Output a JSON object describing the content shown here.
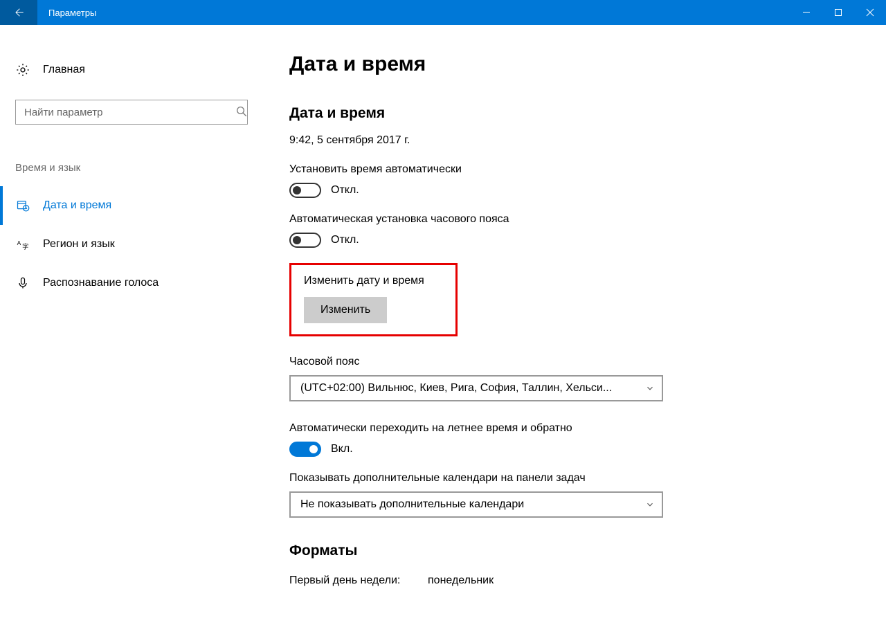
{
  "titlebar": {
    "title": "Параметры"
  },
  "sidebar": {
    "home": "Главная",
    "search_placeholder": "Найти параметр",
    "category": "Время и язык",
    "items": [
      {
        "label": "Дата и время"
      },
      {
        "label": "Регион и язык"
      },
      {
        "label": "Распознавание голоса"
      }
    ]
  },
  "content": {
    "page_title": "Дата и время",
    "section_title": "Дата и время",
    "current_datetime": "9:42, 5 сентября 2017 г.",
    "auto_time": {
      "label": "Установить время автоматически",
      "state": "Откл."
    },
    "auto_tz": {
      "label": "Автоматическая установка часового пояса",
      "state": "Откл."
    },
    "change": {
      "label": "Изменить дату и время",
      "button": "Изменить"
    },
    "timezone": {
      "label": "Часовой пояс",
      "value": "(UTC+02:00) Вильнюс, Киев, Рига, София, Таллин, Хельси..."
    },
    "dst": {
      "label": "Автоматически переходить на летнее время и обратно",
      "state": "Вкл."
    },
    "extra_cal": {
      "label": "Показывать дополнительные календари на панели задач",
      "value": "Не показывать дополнительные календари"
    },
    "formats": {
      "title": "Форматы",
      "first_day_label": "Первый день недели:",
      "first_day_value": "понедельник"
    }
  }
}
